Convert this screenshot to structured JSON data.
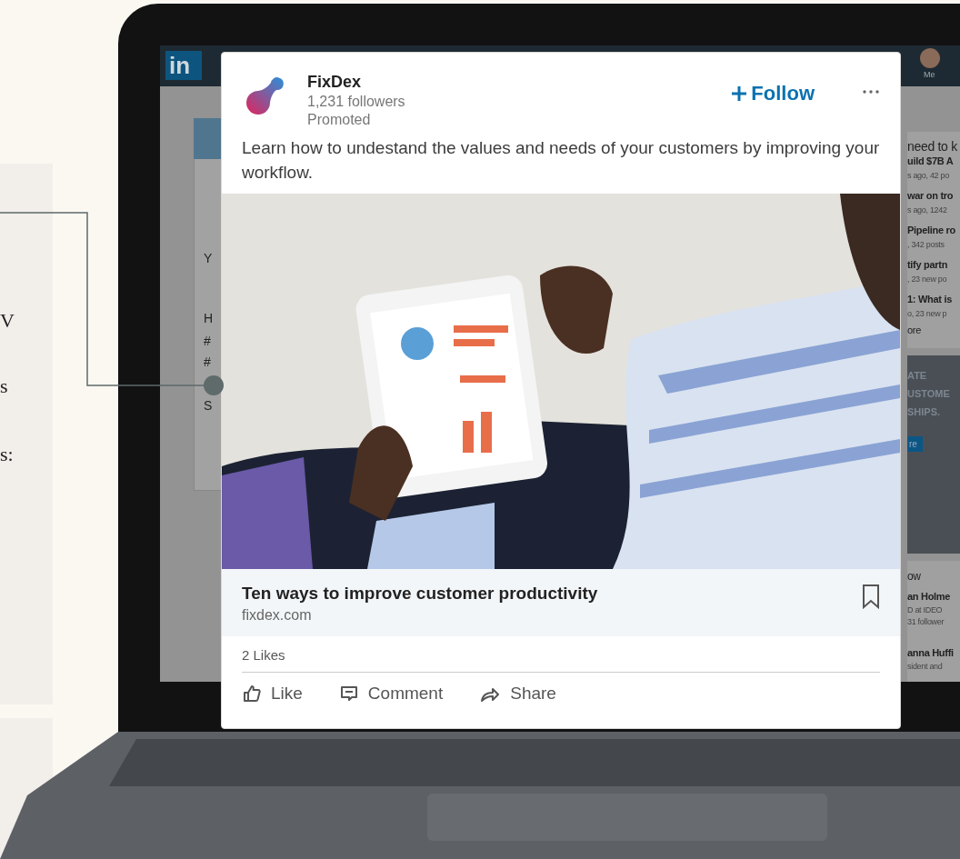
{
  "side_text": [
    "V",
    "s",
    "s:"
  ],
  "feed_behind": {
    "logo": "in",
    "me": "Me",
    "left_card": [
      "Y",
      "H",
      "#",
      "#",
      "S"
    ],
    "news": {
      "title": "need to k",
      "items": [
        {
          "headline": "uild $7B A",
          "meta": "s ago, 42 po"
        },
        {
          "headline": "war on tro",
          "meta": "s ago, 1242"
        },
        {
          "headline": "Pipeline ro",
          "meta": ", 342 posts"
        },
        {
          "headline": "tify partn",
          "meta": ", 23 new po"
        },
        {
          "headline": "1: What is",
          "meta": "o, 23 new p"
        }
      ],
      "more": "ore"
    },
    "ad": {
      "lines": [
        "ATE",
        "USTOME",
        "SHIPS."
      ],
      "button": "re"
    },
    "follow": {
      "title": "ow",
      "people": [
        {
          "name": "an Holme",
          "meta": [
            "D at IDEO",
            "31 follower"
          ]
        },
        {
          "name": "anna Huffi",
          "meta": [
            "sident and"
          ]
        }
      ]
    }
  },
  "post": {
    "company": "FixDex",
    "followers": "1,231 followers",
    "label": "Promoted",
    "follow": "Follow",
    "text": "Learn how to undestand the values and needs of your customers by improving your workflow.",
    "article": {
      "title": "Ten ways to improve customer productivity",
      "domain": "fixdex.com"
    },
    "likes": "2 Likes",
    "actions": [
      {
        "kind": "like",
        "label": "Like"
      },
      {
        "kind": "comment",
        "label": "Comment"
      },
      {
        "kind": "share",
        "label": "Share"
      }
    ]
  }
}
